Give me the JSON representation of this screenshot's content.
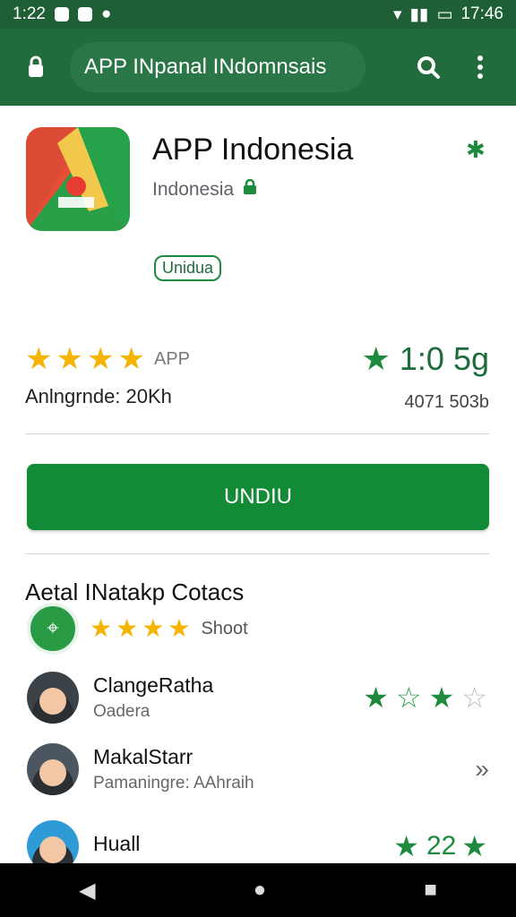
{
  "status": {
    "time_left": "1:22",
    "time_right": "17:46"
  },
  "appbar": {
    "url": "APP INpanal INdomnsais"
  },
  "app": {
    "title": "APP Indonesia",
    "developer": "Indonesia",
    "badge": "Unidua",
    "rating_small": "APP",
    "installs_text": "Anlngrnde: 20Kh",
    "rating_right": "1:0 5g",
    "rating_count": "4071 503b",
    "primary_button": "UNDIU"
  },
  "section": {
    "title": "Aetal INatakp Cotacs",
    "mini_text": "Shoot"
  },
  "reviews": [
    {
      "name": "ClangeRatha",
      "sub": "Oadera",
      "right": ""
    },
    {
      "name": "MakalStarr",
      "sub": "Pamaningre: AAhraih",
      "right": "»"
    },
    {
      "name": "Huall",
      "sub": "",
      "right": "22"
    }
  ],
  "colors": {
    "accent": "#1e8a3e",
    "topbar": "#216b3d",
    "status": "#1f5f35",
    "star_gold": "#f4b400"
  }
}
